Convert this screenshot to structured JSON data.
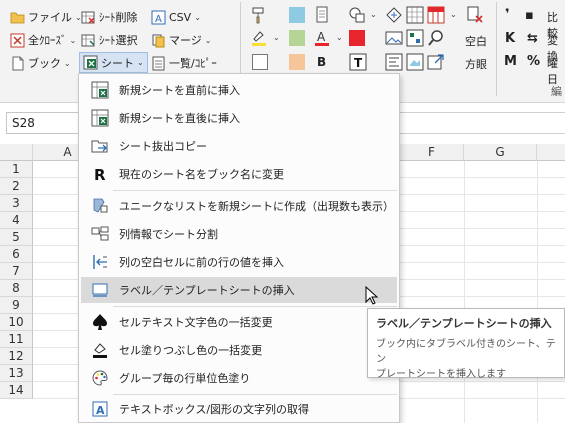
{
  "ribbon": {
    "col1": {
      "file": "ファイル",
      "all_close": "全ｸﾛｰｽﾞ",
      "book": "ブック"
    },
    "col2": {
      "sheet_delete": "ｼｰﾄ削除",
      "sheet_select": "ｼｰﾄ選択",
      "sheet": "シート"
    },
    "col3": {
      "csv": "CSV",
      "merge": "マージ",
      "list_copy": "一覧/ｺﾋﾟｰ"
    },
    "font_controls": {
      "bold": "B",
      "text_tool": "T"
    },
    "spacing": {
      "space": "空白",
      "grid": "方眼"
    },
    "right_partial": {
      "r1": "比較",
      "r2": "変換",
      "r3": "曜日",
      "r4": "編",
      "k": "K",
      "m": "M",
      "pct": "%",
      "quote": "❜"
    },
    "colors": {
      "teal": "#8ecbe3",
      "green": "#b5d597",
      "peach": "#f6c59a",
      "red": "#e8242c",
      "yellow": "#f7e033",
      "excel_green": "#1e7145"
    }
  },
  "namebox": {
    "value": "S28"
  },
  "grid": {
    "columns": [
      "A",
      "F",
      "G"
    ],
    "rows": [
      "1",
      "2",
      "3",
      "4",
      "5",
      "6",
      "7",
      "8",
      "9",
      "10",
      "11",
      "12",
      "13",
      "14"
    ]
  },
  "menu": {
    "items": [
      {
        "label": "新規シートを直前に挿入",
        "icon": "new-sheet-before-icon"
      },
      {
        "label": "新規シートを直後に挿入",
        "icon": "new-sheet-after-icon"
      },
      {
        "label": "シート抜出コピー",
        "icon": "sheet-extract-icon"
      },
      {
        "label": "現在のシート名をブック名に変更",
        "icon": "rename-r-icon"
      },
      {
        "label": "ユニークなリストを新規シートに作成（出現数も表示）",
        "icon": "unique-list-icon"
      },
      {
        "label": "列情報でシート分割",
        "icon": "split-sheet-icon"
      },
      {
        "label": "列の空白セルに前の行の値を挿入",
        "icon": "fill-blank-icon"
      },
      {
        "label": "ラベル／テンプレートシートの挿入",
        "icon": "label-template-icon"
      },
      {
        "label": "セルテキスト文字色の一括変更",
        "icon": "spade-icon"
      },
      {
        "label": "セル塗りつぶし色の一括変更",
        "icon": "fill-bucket-icon"
      },
      {
        "label": "グループ毎の行単位色塗り",
        "icon": "palette-icon"
      },
      {
        "label": "テキストボックス/図形の文字列の取得",
        "icon": "textbox-icon"
      }
    ]
  },
  "tooltip": {
    "title": "ラベル／テンプレートシートの挿入",
    "body_line1": "ブック内にタブラベル付きのシート、テン",
    "body_line2": "プレートシートを挿入します"
  }
}
